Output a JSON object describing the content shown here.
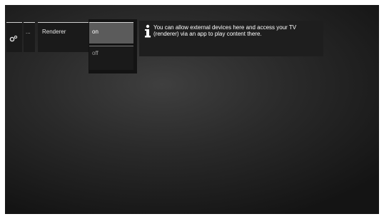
{
  "menu": {
    "settings_icon": "gear-icon",
    "more_label": "...",
    "renderer_label": "Renderer"
  },
  "options": {
    "on_label": "on",
    "off_label": "off",
    "selected": "on"
  },
  "info": {
    "icon": "info-icon",
    "text": "You can allow external devices here and access your TV (renderer) via an app to play content there."
  },
  "colors": {
    "background": "#2a2a2a",
    "selected_option": "#5b5b5b",
    "panel": "#1a1a1a"
  }
}
